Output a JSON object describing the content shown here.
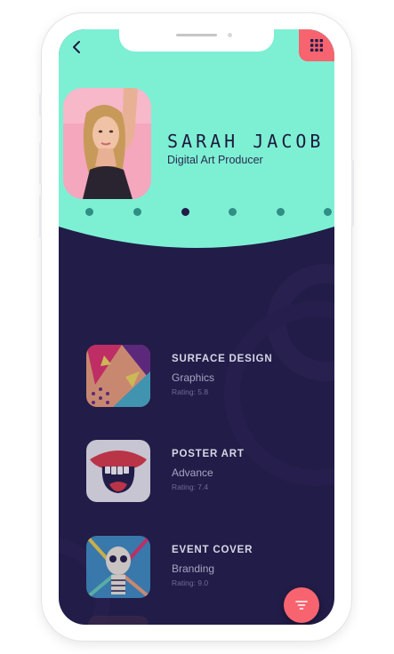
{
  "header": {
    "back_icon": "chevron-left-icon",
    "menu_icon": "grid-icon",
    "accent": "#7df0d4",
    "brand": "#f7646f"
  },
  "profile": {
    "name": "SARAH JACOB",
    "role": "Digital Art Producer",
    "avatar_icon": "profile-photo"
  },
  "pager": {
    "count": 6,
    "active_index": 2
  },
  "projects": [
    {
      "title": "SURFACE DESIGN",
      "category": "Graphics",
      "rating": "Rating: 5.8"
    },
    {
      "title": "POSTER ART",
      "category": "Advance",
      "rating": "Rating: 7.4"
    },
    {
      "title": "EVENT COVER",
      "category": "Branding",
      "rating": "Rating: 9.0"
    }
  ],
  "fab": {
    "icon": "filter-icon"
  },
  "colors": {
    "background": "#221c48",
    "text_dark": "#1e1a3e"
  }
}
